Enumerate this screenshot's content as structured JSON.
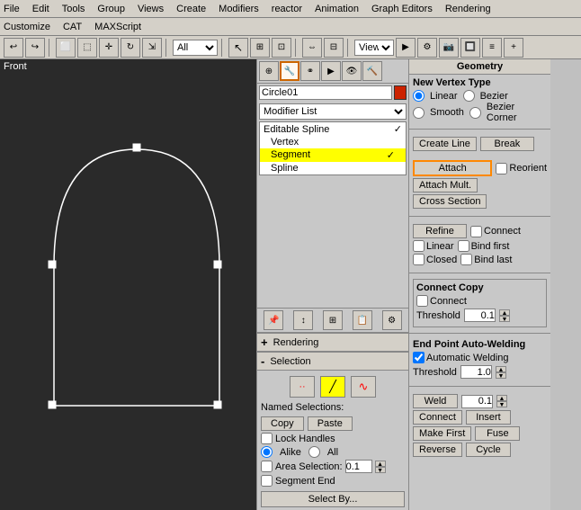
{
  "menubar": {
    "items": [
      "File",
      "Edit",
      "Tools",
      "Group",
      "Views",
      "Create",
      "Modifiers",
      "reactor",
      "Animation",
      "Graph Editors",
      "Rendering"
    ],
    "customize": "Customize",
    "cat": "CAT",
    "maxscript": "MAXScript"
  },
  "toolbar": {
    "dropdown_value": "All",
    "view_label": "View"
  },
  "viewport": {
    "label": "Front"
  },
  "object": {
    "name": "Circle01",
    "color": "#cc2200"
  },
  "modifier_list": {
    "label": "Modifier List",
    "items": [
      {
        "label": "Editable Spline",
        "indent": 0,
        "checked": true
      },
      {
        "label": "Vertex",
        "indent": 1,
        "selected": false
      },
      {
        "label": "Segment",
        "indent": 1,
        "selected": true
      },
      {
        "label": "Spline",
        "indent": 1,
        "selected": false
      }
    ]
  },
  "geometry": {
    "title": "Geometry",
    "new_vertex_type": "New Vertex Type",
    "radio_linear": "Linear",
    "radio_bezier": "Bezier",
    "radio_smooth": "Smooth",
    "radio_bezier_corner": "Bezier Corner",
    "create_line": "Create Line",
    "break": "Break",
    "attach": "Attach",
    "reorient": "Reorient",
    "attach_mult": "Attach Mult.",
    "cross_section": "Cross Section",
    "refine": "Refine",
    "connect": "Connect",
    "linear_check": "Linear",
    "closed": "Closed",
    "bind_first": "Bind first",
    "bind_last": "Bind last",
    "connect_copy_label": "Connect Copy",
    "connect_copy_check": "Connect",
    "threshold_label": "Threshold",
    "threshold_value": "0.1",
    "end_point_label": "End Point Auto-Welding",
    "auto_welding_check": "Automatic Welding",
    "threshold2_label": "Threshold",
    "threshold2_value": "1.0",
    "weld": "Weld",
    "weld_value": "0.1",
    "connect2": "Connect",
    "insert": "Insert",
    "make_first": "Make First",
    "fuse": "Fuse",
    "reverse": "Reverse",
    "cycle": "Cycle"
  },
  "panels": {
    "rendering": {
      "label": "Rendering",
      "sign": "+"
    },
    "selection": {
      "label": "Selection",
      "sign": "-",
      "icons": [
        "dots",
        "vertex",
        "wave"
      ],
      "named_selections": "Named Selections:",
      "copy": "Copy",
      "paste": "Paste",
      "lock_handles": "Lock Handles",
      "alike": "Alike",
      "all": "All",
      "area_selection": "Area Selection:",
      "area_value": "0.1",
      "segment_end": "Segment End",
      "select_by": "Select By..."
    }
  }
}
